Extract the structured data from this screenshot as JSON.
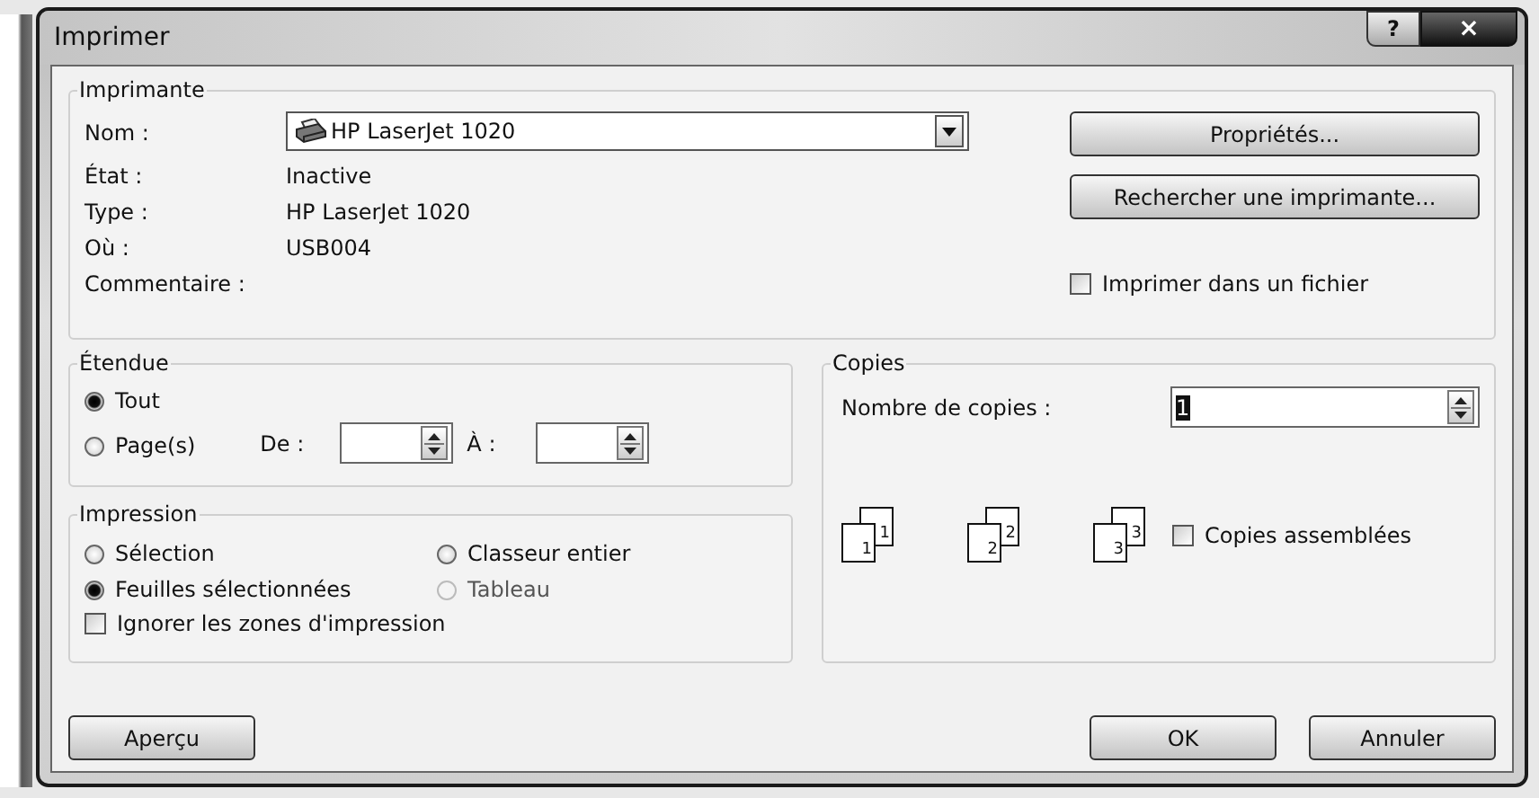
{
  "window": {
    "title": "Imprimer",
    "help": "?",
    "close": "×"
  },
  "printer": {
    "legend": "Imprimante",
    "fields": [
      {
        "label": "Nom :",
        "kind": "combo",
        "value": "HP LaserJet 1020"
      },
      {
        "label": "État :",
        "kind": "text",
        "value": "Inactive"
      },
      {
        "label": "Type :",
        "kind": "text",
        "value": "HP LaserJet 1020"
      },
      {
        "label": "Où :",
        "kind": "text",
        "value": "USB004"
      },
      {
        "label": "Commentaire :",
        "kind": "text"
      }
    ],
    "buttons": [
      "Propriétés...",
      "Rechercher une imprimante..."
    ],
    "print_to_file": {
      "label": "Imprimer dans un fichier",
      "checked": false
    }
  },
  "range": {
    "legend": "Étendue",
    "options": [
      {
        "label": "Tout",
        "selected": true
      },
      {
        "label": "Page(s)",
        "selected": false
      }
    ],
    "from_label": "De :",
    "to_label": "À :"
  },
  "print_what": {
    "legend": "Impression",
    "options": [
      {
        "label": "Sélection",
        "selected": false,
        "disabled": false
      },
      {
        "label": "Classeur entier",
        "selected": false,
        "disabled": false
      },
      {
        "label": "Feuilles sélectionnées",
        "selected": true,
        "disabled": false
      },
      {
        "label": "Tableau",
        "selected": false,
        "disabled": true
      }
    ],
    "ignore_areas": {
      "label": "Ignorer les zones d'impression",
      "checked": false
    }
  },
  "copies": {
    "legend": "Copies",
    "count_label": "Nombre de copies :",
    "count": "1",
    "stacks": [
      {
        "back": "1",
        "front": "1"
      },
      {
        "back": "2",
        "front": "2"
      },
      {
        "back": "3",
        "front": "3"
      }
    ],
    "collate": {
      "label": "Copies assemblées",
      "checked": false
    }
  },
  "buttons": {
    "preview": "Aperçu",
    "ok": "OK",
    "cancel": "Annuler"
  }
}
